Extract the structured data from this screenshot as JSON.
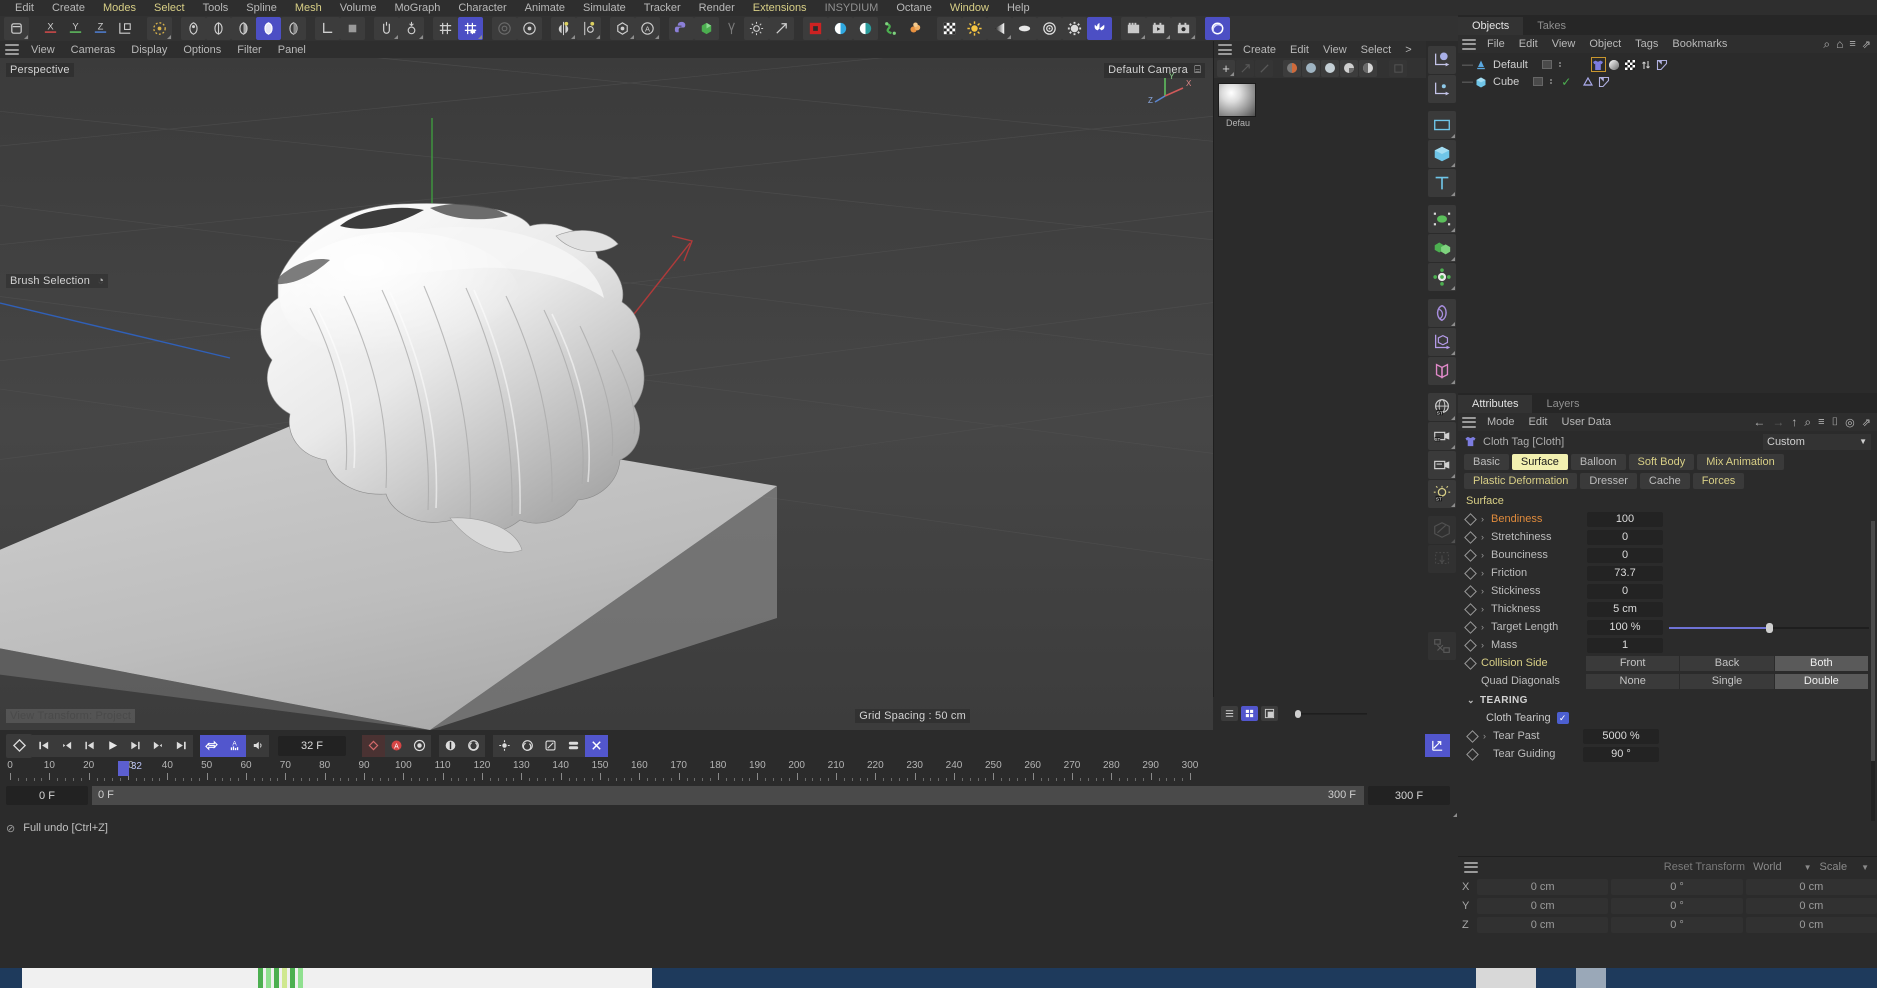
{
  "menubar": {
    "items": [
      {
        "label": "Edit",
        "style": "normal"
      },
      {
        "label": "Create",
        "style": "normal"
      },
      {
        "label": "Modes",
        "style": "hl"
      },
      {
        "label": "Select",
        "style": "hl"
      },
      {
        "label": "Tools",
        "style": "normal"
      },
      {
        "label": "Spline",
        "style": "normal"
      },
      {
        "label": "Mesh",
        "style": "hl"
      },
      {
        "label": "Volume",
        "style": "normal"
      },
      {
        "label": "MoGraph",
        "style": "normal"
      },
      {
        "label": "Character",
        "style": "normal"
      },
      {
        "label": "Animate",
        "style": "normal"
      },
      {
        "label": "Simulate",
        "style": "normal"
      },
      {
        "label": "Tracker",
        "style": "normal"
      },
      {
        "label": "Render",
        "style": "normal"
      },
      {
        "label": "Extensions",
        "style": "hl"
      },
      {
        "label": "INSYDIUM",
        "style": "dim"
      },
      {
        "label": "Octane",
        "style": "normal"
      },
      {
        "label": "Window",
        "style": "hl"
      },
      {
        "label": "Help",
        "style": "normal"
      }
    ]
  },
  "viewport_menu": {
    "items": [
      "View",
      "Cameras",
      "Display",
      "Options",
      "Filter",
      "Panel"
    ]
  },
  "viewport": {
    "projection_label": "Perspective",
    "camera_label": "Default Camera",
    "brush_label": "Brush Selection",
    "view_transform_label": "View Transform: Project",
    "grid_spacing_label": "Grid Spacing : 50 cm",
    "axis_labels": {
      "x": "X",
      "y": "Y",
      "z": "Z"
    }
  },
  "material_manager": {
    "menu": [
      "Create",
      "Edit",
      "View",
      "Select",
      ">"
    ],
    "materials": [
      {
        "name": "Defau"
      }
    ]
  },
  "object_manager": {
    "tabs": [
      {
        "label": "Objects",
        "active": true
      },
      {
        "label": "Takes",
        "active": false
      }
    ],
    "menu": [
      "File",
      "Edit",
      "View",
      "Object",
      "Tags",
      "Bookmarks"
    ],
    "objects": [
      {
        "name": "Default",
        "icon": "light-icon",
        "visible_dots": true,
        "check": false,
        "tags": [
          "cloth-tag",
          "material-tag",
          "texture-tag",
          "alignment-tag",
          "phong-tag"
        ],
        "selected_tag": 0
      },
      {
        "name": "Cube",
        "icon": "cube-icon",
        "visible_dots": true,
        "check": true,
        "tags": [
          "collider-tag",
          "phong-tag"
        ],
        "selected_tag": -1
      }
    ]
  },
  "attributes": {
    "tabs": [
      {
        "label": "Attributes",
        "active": true
      },
      {
        "label": "Layers",
        "active": false
      }
    ],
    "menu": [
      "Mode",
      "Edit",
      "User Data"
    ],
    "title": "Cloth Tag [Cloth]",
    "preset": "Custom",
    "property_tabs": [
      {
        "label": "Basic",
        "state": "normal"
      },
      {
        "label": "Surface",
        "state": "selected"
      },
      {
        "label": "Balloon",
        "state": "normal"
      },
      {
        "label": "Soft Body",
        "state": "yellow"
      },
      {
        "label": "Mix Animation",
        "state": "yellow"
      },
      {
        "label": "Plastic Deformation",
        "state": "yellow"
      },
      {
        "label": "Dresser",
        "state": "normal"
      },
      {
        "label": "Cache",
        "state": "normal"
      },
      {
        "label": "Forces",
        "state": "yellow"
      }
    ],
    "section_title": "Surface",
    "properties": [
      {
        "label": "Bendiness",
        "value": "100",
        "label_color": "orange",
        "type": "field"
      },
      {
        "label": "Stretchiness",
        "value": "0",
        "label_color": "normal",
        "type": "field"
      },
      {
        "label": "Bounciness",
        "value": "0",
        "label_color": "normal",
        "type": "field"
      },
      {
        "label": "Friction",
        "value": "73.7",
        "label_color": "normal",
        "type": "field"
      },
      {
        "label": "Stickiness",
        "value": "0",
        "label_color": "normal",
        "type": "field"
      },
      {
        "label": "Thickness",
        "value": "5 cm",
        "label_color": "normal",
        "type": "field"
      },
      {
        "label": "Target Length",
        "value": "100 %",
        "label_color": "normal",
        "type": "slider",
        "slider_pct": 50
      },
      {
        "label": "Mass",
        "value": "1",
        "label_color": "normal",
        "type": "field"
      }
    ],
    "segmented": [
      {
        "label": "Collision Side",
        "label_color": "yellow",
        "has_key": true,
        "options": [
          "Front",
          "Back",
          "Both"
        ],
        "selected": 2
      },
      {
        "label": "Quad Diagonals",
        "label_color": "normal",
        "has_key": false,
        "options": [
          "None",
          "Single",
          "Double"
        ],
        "selected": 2
      }
    ],
    "tearing_group": {
      "title": "TEARING",
      "checkbox_label": "Cloth Tearing",
      "checkbox_checked": true,
      "properties": [
        {
          "label": "Tear Past",
          "value": "5000 %",
          "arrow": true
        },
        {
          "label": "Tear Guiding",
          "value": "90 °",
          "arrow": false
        }
      ]
    }
  },
  "coordinates": {
    "reset_label": "Reset Transform",
    "space_label": "World",
    "mode_label": "Scale",
    "rows": [
      {
        "axis": "X",
        "position": "0 cm",
        "rotation": "0 °",
        "size": "0 cm"
      },
      {
        "axis": "Y",
        "position": "0 cm",
        "rotation": "0 °",
        "size": "0 cm"
      },
      {
        "axis": "Z",
        "position": "0 cm",
        "rotation": "0 °",
        "size": "0 cm"
      }
    ]
  },
  "timeline": {
    "current_frame_label": "32 F",
    "playhead_frame": 32,
    "start_frame_label": "0 F",
    "preview_start_label": "0 F",
    "preview_end_label": "300 F",
    "end_frame_label": "300 F",
    "ruler_ticks": [
      0,
      10,
      20,
      30,
      40,
      50,
      60,
      70,
      80,
      90,
      100,
      110,
      120,
      130,
      140,
      150,
      160,
      170,
      180,
      190,
      200,
      210,
      220,
      230,
      240,
      250,
      260,
      270,
      280,
      290,
      300
    ],
    "range_max": 300
  },
  "status_bar": {
    "message": "Full undo [Ctrl+Z]"
  },
  "colors": {
    "accent_blue": "#5256cd",
    "highlight_yellow": "#d8cf86",
    "selected_tab_bg": "#f2f0b0",
    "orange_label": "#e08b3c",
    "panel_bg": "#2b2b2b",
    "toolbar_bg": "#323232",
    "taskbar": "#1e3a5c"
  }
}
